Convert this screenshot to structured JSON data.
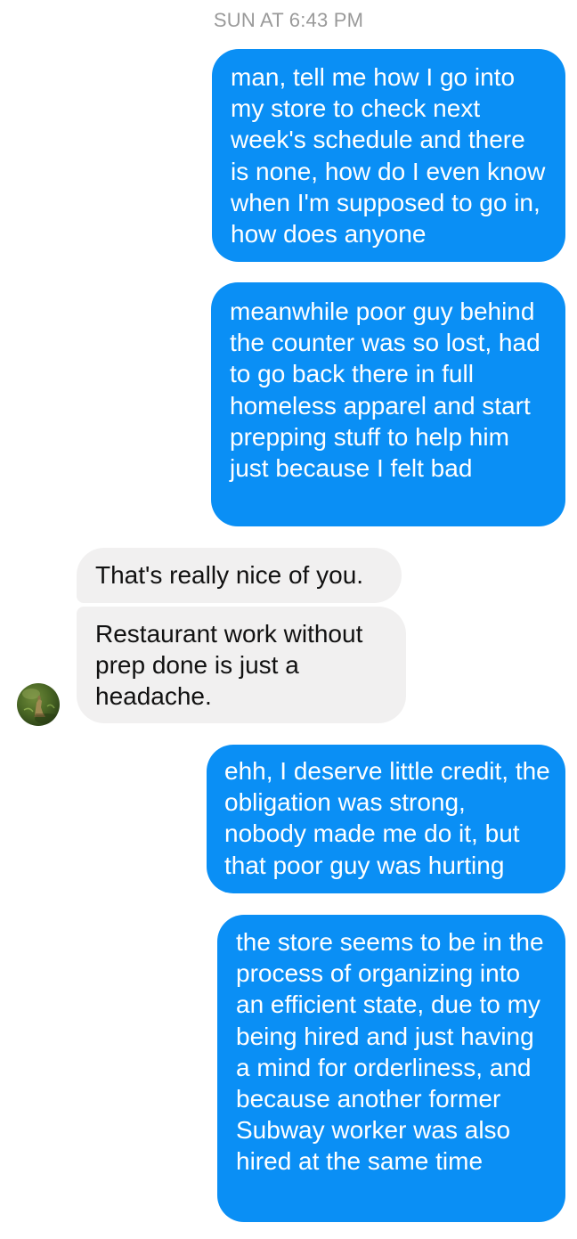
{
  "conversation": {
    "timestamp": "SUN AT 6:43 PM",
    "messages": [
      {
        "direction": "outgoing",
        "text": "man, tell me how I go into my store to check next week's schedule and there is none, how do I even know when I'm supposed to go in, how does anyone"
      },
      {
        "direction": "outgoing",
        "text": "meanwhile poor guy behind the counter was so lost, had to go back there in full homeless apparel and start prepping stuff to help him just because I felt bad"
      },
      {
        "direction": "incoming",
        "text": "That's really nice of you."
      },
      {
        "direction": "incoming",
        "text": "Restaurant work without prep done is just a headache."
      },
      {
        "direction": "outgoing",
        "text": "ehh, I deserve little credit, the obligation was strong, nobody made me do it, but that poor guy was hurting"
      },
      {
        "direction": "outgoing",
        "text": "the store seems to be in the process of organizing into an efficient state, due to my being hired and just having a mind for orderliness, and because another former Subway worker was also hired at the same time"
      }
    ]
  },
  "colors": {
    "outgoing_bubble": "#0a8ff5",
    "incoming_bubble": "#f1f0f0",
    "timestamp": "#9a9a9a"
  },
  "icons": {
    "contact_avatar": "contact-avatar-photo"
  }
}
